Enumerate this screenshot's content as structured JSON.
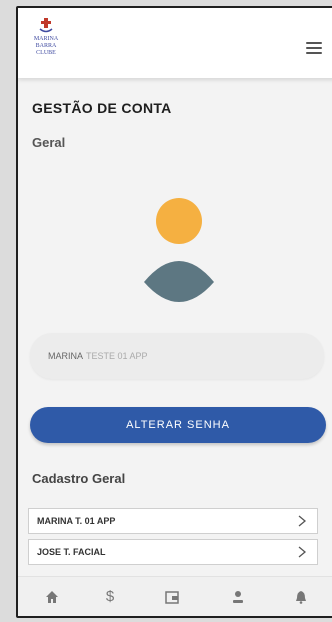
{
  "header": {
    "logo_line1": "MARINA",
    "logo_line2": "BARRA CLUBE"
  },
  "main": {
    "title": "GESTÃO DE CONTA",
    "subtitle": "Geral",
    "user_name_part1": "MARINA",
    "user_name_part2": "TESTE 01 APP",
    "change_password_label": "ALTERAR SENHA",
    "cadastro_title": "Cadastro Geral",
    "cadastro_items": [
      {
        "label": "MARINA T. 01 APP"
      },
      {
        "label": "JOSE T. FACIAL"
      }
    ]
  },
  "colors": {
    "primary_button": "#2f5aa8",
    "avatar_head": "#f5b041",
    "avatar_body": "#5d7782"
  },
  "bottom_nav": {
    "icons": [
      "home-icon",
      "dollar-icon",
      "wallet-icon",
      "user-icon",
      "bell-icon"
    ]
  }
}
